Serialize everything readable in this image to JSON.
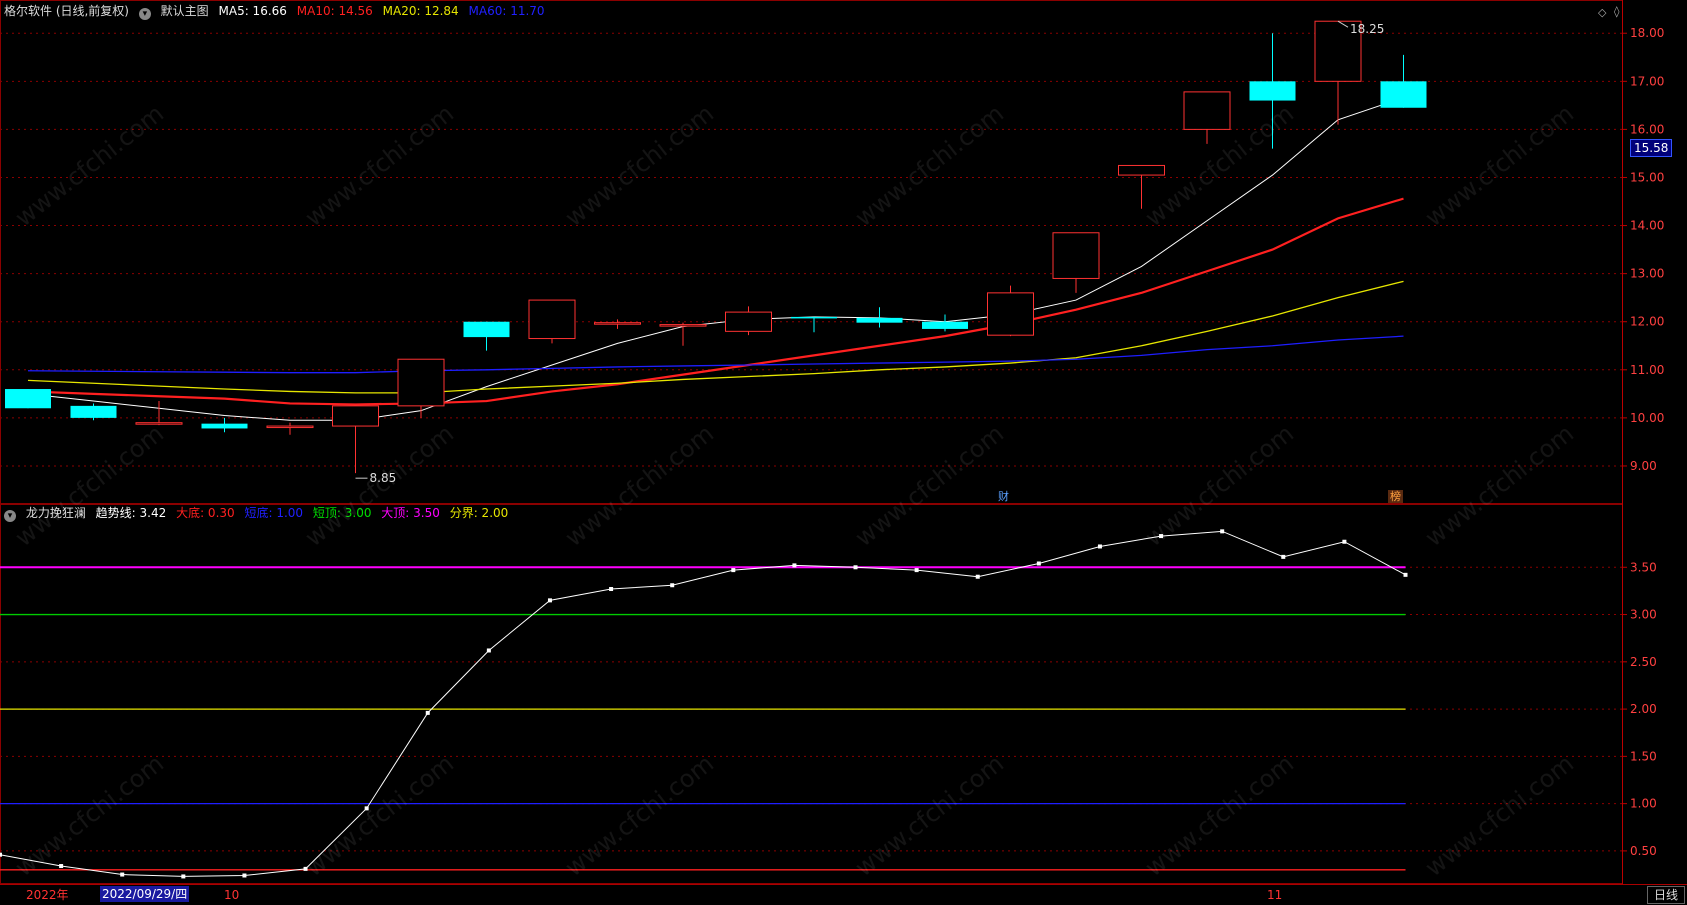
{
  "main_legend": {
    "title": "格尔软件 (日线,前复权)",
    "chart_name": "默认主图",
    "ma5": "MA5: 16.66",
    "ma10": "MA10: 14.56",
    "ma20": "MA20: 12.84",
    "ma60": "MA60: 11.70"
  },
  "sub_legend": {
    "indicator": "龙力挽狂澜",
    "trend": "趋势线: 3.42",
    "big_bottom": "大底: 0.30",
    "low": "短底: 1.00",
    "short_top": "短顶: 3.00",
    "big_top": "大顶: 3.50",
    "divide": "分界: 2.00"
  },
  "current_price": "15.58",
  "high_label": "18.25",
  "low_label": "8.85",
  "flags": {
    "fin": "财",
    "rank": "榜"
  },
  "bottom_axis": {
    "year": "2022年",
    "date": "2022/09/29/四",
    "oct": "10",
    "nov": "11",
    "period": "日线"
  },
  "watermark": "www.cfchi.com",
  "colors": {
    "up": "#ff3232",
    "down": "#00ffff",
    "ma5": "#ffffff",
    "ma10": "#ff2020",
    "ma20": "#e6e600",
    "ma60": "#1e1eff",
    "bigtop": "#ff00ff",
    "shorttop": "#00cc00",
    "divide": "#e6e600",
    "low": "#1e1eff",
    "bigbottom": "#ff2020",
    "grid": "#8b0000"
  },
  "chart_data": [
    {
      "type": "candlestick",
      "ylim": [
        8.5,
        18.4
      ],
      "y_ticks": [
        "9.00",
        "10.00",
        "11.00",
        "12.00",
        "13.00",
        "14.00",
        "15.00",
        "16.00",
        "17.00",
        "18.00"
      ],
      "candles": [
        {
          "o": 10.6,
          "c": 10.2,
          "h": 10.6,
          "l": 10.2
        },
        {
          "o": 10.25,
          "c": 10.0,
          "h": 10.3,
          "l": 9.95
        },
        {
          "o": 9.9,
          "c": 9.9,
          "h": 10.35,
          "l": 9.85
        },
        {
          "o": 9.88,
          "c": 9.78,
          "h": 10.0,
          "l": 9.7
        },
        {
          "o": 9.8,
          "c": 9.83,
          "h": 9.9,
          "l": 9.65
        },
        {
          "o": 9.83,
          "c": 10.25,
          "h": 10.25,
          "l": 8.85
        },
        {
          "o": 10.25,
          "c": 11.22,
          "h": 11.22,
          "l": 10.0
        },
        {
          "o": 12.0,
          "c": 11.68,
          "h": 12.0,
          "l": 11.4
        },
        {
          "o": 11.65,
          "c": 12.45,
          "h": 12.45,
          "l": 11.55
        },
        {
          "o": 11.96,
          "c": 11.98,
          "h": 12.05,
          "l": 11.85
        },
        {
          "o": 11.92,
          "c": 11.94,
          "h": 11.98,
          "l": 11.5
        },
        {
          "o": 11.8,
          "c": 12.2,
          "h": 12.32,
          "l": 11.72
        },
        {
          "o": 12.1,
          "c": 12.08,
          "h": 12.1,
          "l": 11.78
        },
        {
          "o": 12.08,
          "c": 11.98,
          "h": 12.3,
          "l": 11.88
        },
        {
          "o": 12.0,
          "c": 11.85,
          "h": 12.15,
          "l": 11.8
        },
        {
          "o": 11.72,
          "c": 12.6,
          "h": 12.75,
          "l": 11.7
        },
        {
          "o": 12.9,
          "c": 13.85,
          "h": 13.85,
          "l": 12.6
        },
        {
          "o": 15.05,
          "c": 15.25,
          "h": 15.25,
          "l": 14.35
        },
        {
          "o": 16.0,
          "c": 16.78,
          "h": 16.78,
          "l": 15.7
        },
        {
          "o": 17.0,
          "c": 16.6,
          "h": 18.0,
          "l": 15.6
        },
        {
          "o": 17.0,
          "c": 18.25,
          "h": 18.25,
          "l": 16.1
        },
        {
          "o": 17.0,
          "c": 16.45,
          "h": 17.55,
          "l": 16.45
        }
      ],
      "series": [
        {
          "name": "MA5",
          "values": [
            10.5,
            10.35,
            10.2,
            10.05,
            9.95,
            9.95,
            10.15,
            10.65,
            11.1,
            11.55,
            11.9,
            12.05,
            12.1,
            12.08,
            12.0,
            12.15,
            12.45,
            13.15,
            14.1,
            15.05,
            16.2,
            16.66
          ]
        },
        {
          "name": "MA10",
          "values": [
            10.55,
            10.5,
            10.45,
            10.4,
            10.3,
            10.28,
            10.3,
            10.35,
            10.55,
            10.7,
            10.9,
            11.1,
            11.3,
            11.5,
            11.7,
            11.95,
            12.25,
            12.6,
            13.05,
            13.5,
            14.15,
            14.56
          ]
        },
        {
          "name": "MA20",
          "values": [
            10.78,
            10.72,
            10.66,
            10.6,
            10.55,
            10.52,
            10.52,
            10.6,
            10.66,
            10.72,
            10.8,
            10.86,
            10.92,
            11.0,
            11.06,
            11.14,
            11.25,
            11.5,
            11.8,
            12.12,
            12.5,
            12.84
          ]
        },
        {
          "name": "MA60",
          "values": [
            10.98,
            10.97,
            10.96,
            10.95,
            10.94,
            10.94,
            10.98,
            11.0,
            11.03,
            11.06,
            11.08,
            11.1,
            11.12,
            11.14,
            11.16,
            11.18,
            11.22,
            11.3,
            11.42,
            11.5,
            11.62,
            11.7
          ]
        }
      ]
    },
    {
      "type": "line",
      "ylim": [
        0.15,
        4.0
      ],
      "y_ticks": [
        "0.50",
        "1.00",
        "1.50",
        "2.00",
        "2.50",
        "3.00",
        "3.50"
      ],
      "series": [
        {
          "name": "趋势线",
          "values": [
            0.46,
            0.34,
            0.25,
            0.23,
            0.24,
            0.31,
            0.95,
            1.96,
            2.62,
            3.15,
            3.27,
            3.31,
            3.47,
            3.52,
            3.5,
            3.47,
            3.4,
            3.54,
            3.72,
            3.83,
            3.88,
            3.61,
            3.77,
            3.42
          ]
        }
      ],
      "levels": [
        {
          "name": "大顶",
          "value": 3.5
        },
        {
          "name": "短顶",
          "value": 3.0
        },
        {
          "name": "分界",
          "value": 2.0
        },
        {
          "name": "短底",
          "value": 1.0
        },
        {
          "name": "大底",
          "value": 0.3
        }
      ]
    }
  ]
}
